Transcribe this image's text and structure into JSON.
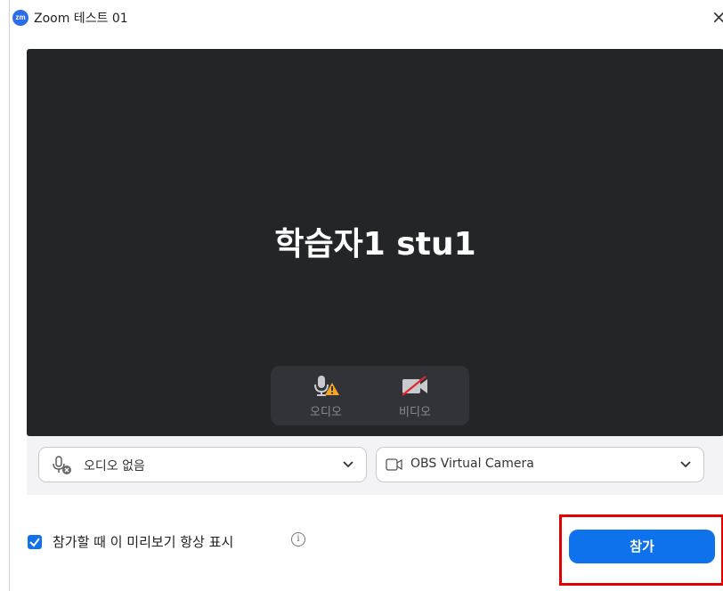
{
  "window": {
    "app_icon_text": "zm",
    "title": "Zoom 테스트 01",
    "close_glyph": "×"
  },
  "preview": {
    "participant_name": "학습자1 stu1",
    "audio_toggle": {
      "label": "오디오",
      "icon": "mic-warning-icon"
    },
    "video_toggle": {
      "label": "비디오",
      "icon": "video-off-icon"
    }
  },
  "devices": {
    "audio": {
      "value": "오디오 없음",
      "icon": "mic-disabled-icon"
    },
    "video": {
      "value": "OBS Virtual Camera",
      "icon": "camera-icon"
    }
  },
  "footer": {
    "always_show_preview_label": "참가할 때 이 미리보기 항상 표시",
    "always_show_preview_checked": true,
    "join_label": "참가"
  },
  "colors": {
    "accent": "#0e72ed",
    "preview_bg": "#242529",
    "warning": "#f5a623",
    "highlight": "#e00000"
  }
}
